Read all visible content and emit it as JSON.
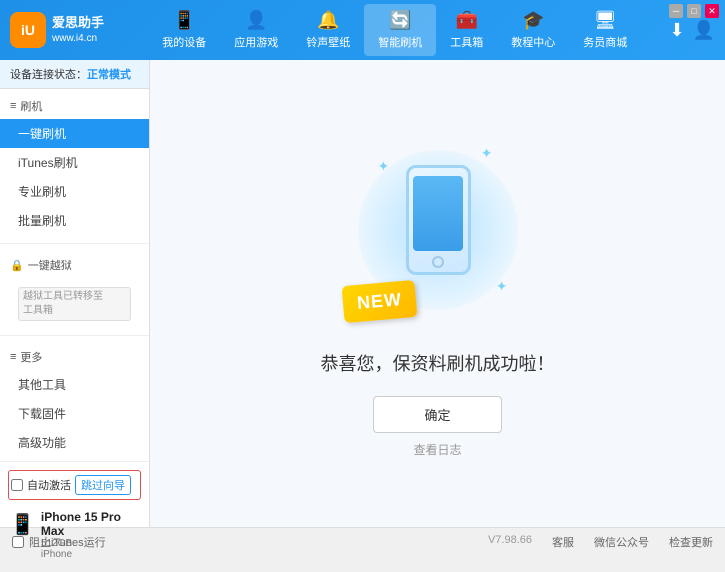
{
  "app": {
    "logo_short": "iU",
    "logo_brand": "爱思助手",
    "logo_url": "www.i4.cn"
  },
  "nav": {
    "items": [
      {
        "id": "my-device",
        "icon": "📱",
        "label": "我的设备"
      },
      {
        "id": "apps-games",
        "icon": "👤",
        "label": "应用游戏"
      },
      {
        "id": "ringtones",
        "icon": "🔔",
        "label": "铃声壁纸"
      },
      {
        "id": "smart-flash",
        "icon": "🔄",
        "label": "智能刷机",
        "active": true
      },
      {
        "id": "toolbox",
        "icon": "🧰",
        "label": "工具箱"
      },
      {
        "id": "tutorial",
        "icon": "🎓",
        "label": "教程中心"
      },
      {
        "id": "service",
        "icon": "🖥",
        "label": "务员商城"
      }
    ]
  },
  "status": {
    "label": "设备连接状态：",
    "mode": "正常模式"
  },
  "sidebar": {
    "section_flash": "刷机",
    "items": [
      {
        "id": "one-key-flash",
        "label": "一键刷机",
        "active": true
      },
      {
        "id": "itunes-flash",
        "label": "iTunes刷机"
      },
      {
        "id": "pro-flash",
        "label": "专业刷机"
      },
      {
        "id": "batch-flash",
        "label": "批量刷机"
      }
    ],
    "section_jailbreak": "一键越狱",
    "jailbreak_disabled": true,
    "jailbreak_note": "越狱工具已转移至\n工具箱",
    "section_more": "更多",
    "more_items": [
      {
        "id": "other-tools",
        "label": "其他工具"
      },
      {
        "id": "download-firmware",
        "label": "下载固件"
      },
      {
        "id": "advanced",
        "label": "高级功能"
      }
    ]
  },
  "bottom": {
    "auto_activate_label": "自动激活",
    "guide_btn_label": "跳过向导",
    "device_name": "iPhone 15 Pro Max",
    "device_storage": "512GB",
    "device_type": "iPhone"
  },
  "content": {
    "new_badge": "NEW",
    "success_text": "恭喜您，保资料刷机成功啦！",
    "confirm_btn": "确定",
    "log_link": "查看日志"
  },
  "footer": {
    "itunes_label": "阻止iTunes运行",
    "version": "V7.98.66",
    "links": [
      "客服",
      "微信公众号",
      "检查更新"
    ]
  }
}
